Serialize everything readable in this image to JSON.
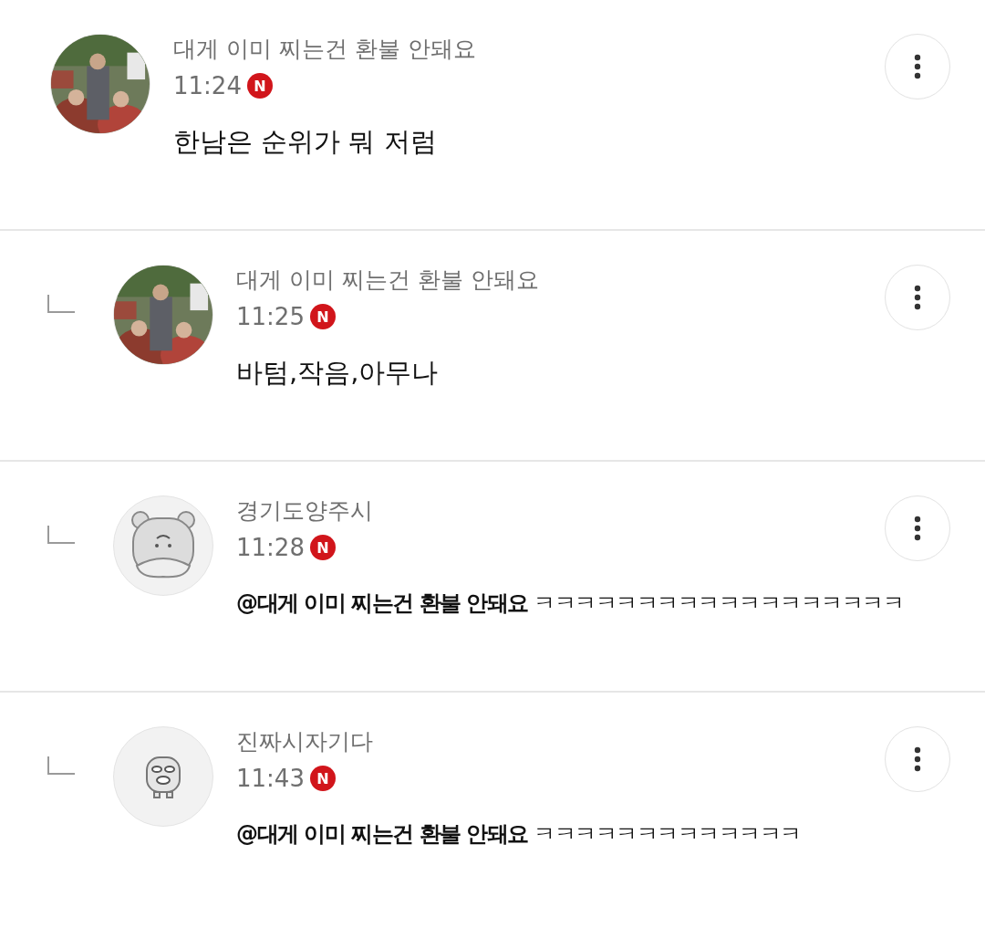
{
  "comments": [
    {
      "reply": false,
      "author": "대게 이미 찌는건 환불 안돼요",
      "time": "11:24",
      "badge": "N",
      "text": "한남은 순위가 뭐 저럼"
    },
    {
      "reply": true,
      "author": "대게 이미 찌는건 환불 안돼요",
      "time": "11:25",
      "badge": "N",
      "text": "바텀,작음,아무나"
    },
    {
      "reply": true,
      "avatar": {
        "kind": "bear"
      },
      "author": "경기도양주시",
      "time": "11:28",
      "badge": "N",
      "text": "**@대게 이미 찌는건 환불 안돼요** ㅋㅋㅋㅋㅋㅋㅋㅋㅋㅋㅋㅋㅋㅋㅋㅋㅋㅋ"
    },
    {
      "reply": true,
      "avatar": {
        "kind": "creature"
      },
      "author": "진짜시자기다",
      "time": "11:43",
      "badge": "N",
      "text": "**@대게 이미 찌는건 환불 안돼요** ㅋㅋㅋㅋㅋㅋㅋㅋㅋㅋㅋㅋㅋ"
    }
  ]
}
